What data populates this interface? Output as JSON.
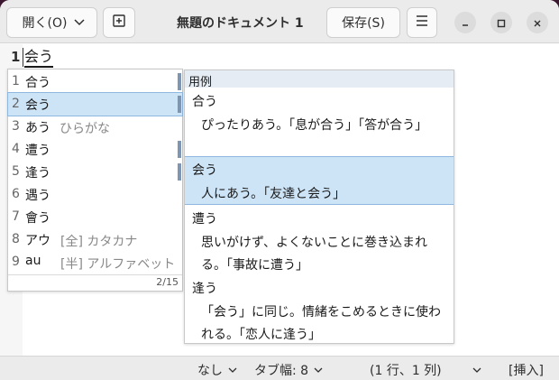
{
  "window": {
    "title": "無題のドキュメント 1",
    "open_label": "開く(O)",
    "save_label": "保存(S)"
  },
  "editor": {
    "line_number": "1",
    "preedit_text": "会う"
  },
  "candidates": {
    "items": [
      {
        "num": "1",
        "text": "合う",
        "sub": "",
        "marked": true
      },
      {
        "num": "2",
        "text": "会う",
        "sub": "",
        "marked": true,
        "selected": true
      },
      {
        "num": "3",
        "text": "あう",
        "sub": "ひらがな",
        "marked": false
      },
      {
        "num": "4",
        "text": "遭う",
        "sub": "",
        "marked": true
      },
      {
        "num": "5",
        "text": "逢う",
        "sub": "",
        "marked": true
      },
      {
        "num": "6",
        "text": "遇う",
        "sub": "",
        "marked": false
      },
      {
        "num": "7",
        "text": "會う",
        "sub": "",
        "marked": false
      },
      {
        "num": "8",
        "text": "アウ",
        "sub": "[全] カタカナ",
        "marked": false
      },
      {
        "num": "9",
        "text": "au",
        "sub": "[半] アルファベット",
        "marked": false
      }
    ],
    "pager": "2/15"
  },
  "usage": {
    "title": "用例",
    "entries": [
      {
        "head": "合う",
        "desc": "ぴったりあう。「息が合う」「答が合う」"
      },
      {
        "head": "会う",
        "desc": "人にあう。「友達と会う」",
        "selected": true
      },
      {
        "head": "遭う",
        "desc": "思いがけず、よくないことに巻き込まれる。「事故に遭う」"
      },
      {
        "head": "逢う",
        "desc": "「会う」に同じ。情緒をこめるときに使われる。「恋人に逢う」"
      }
    ]
  },
  "statusbar": {
    "syntax": "なし",
    "tab_width": "タブ幅: 8",
    "position": "(1 行、1 列)",
    "insert_mode": "[挿入]"
  },
  "colors": {
    "selection": "#cde4f7",
    "headerbar": "#ebebeb",
    "scroll_mark": "#7f96b3"
  }
}
